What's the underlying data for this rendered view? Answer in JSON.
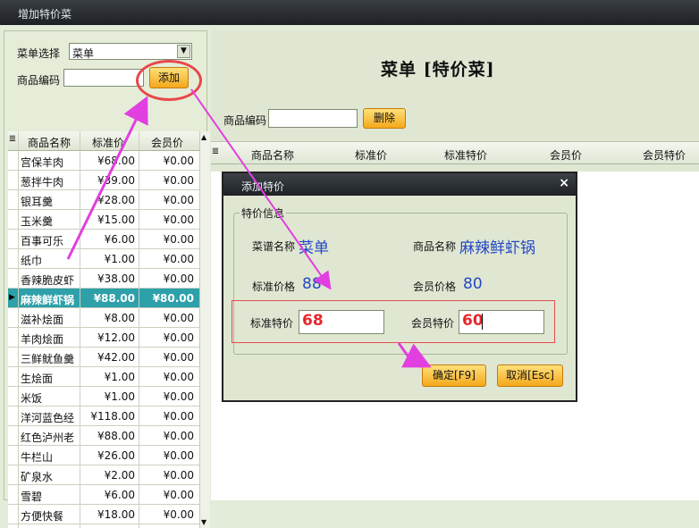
{
  "window": {
    "title": "增加特价菜"
  },
  "left": {
    "menu_select_label": "菜单选择",
    "menu_select_value": "菜单",
    "code_label": "商品编码",
    "code_value": "",
    "add_button": "添加",
    "columns": [
      "商品名称",
      "标准价",
      "会员价"
    ],
    "rows": [
      {
        "name": "宫保羊肉",
        "std": "¥68.00",
        "member": "¥0.00"
      },
      {
        "name": "葱拌牛肉",
        "std": "¥39.00",
        "member": "¥0.00"
      },
      {
        "name": "银耳羹",
        "std": "¥28.00",
        "member": "¥0.00"
      },
      {
        "name": "玉米羹",
        "std": "¥15.00",
        "member": "¥0.00"
      },
      {
        "name": "百事可乐",
        "std": "¥6.00",
        "member": "¥0.00"
      },
      {
        "name": "纸巾",
        "std": "¥1.00",
        "member": "¥0.00"
      },
      {
        "name": "香辣脆皮虾",
        "std": "¥38.00",
        "member": "¥0.00"
      },
      {
        "name": "麻辣鲜虾锅",
        "std": "¥88.00",
        "member": "¥80.00"
      },
      {
        "name": "滋补烩面",
        "std": "¥8.00",
        "member": "¥0.00"
      },
      {
        "name": "羊肉烩面",
        "std": "¥12.00",
        "member": "¥0.00"
      },
      {
        "name": "三鲜鱿鱼羹",
        "std": "¥42.00",
        "member": "¥0.00"
      },
      {
        "name": "生烩面",
        "std": "¥1.00",
        "member": "¥0.00"
      },
      {
        "name": "米饭",
        "std": "¥1.00",
        "member": "¥0.00"
      },
      {
        "name": "洋河蓝色经",
        "std": "¥118.00",
        "member": "¥0.00"
      },
      {
        "name": "红色泸州老",
        "std": "¥88.00",
        "member": "¥0.00"
      },
      {
        "name": "牛栏山",
        "std": "¥26.00",
        "member": "¥0.00"
      },
      {
        "name": "矿泉水",
        "std": "¥2.00",
        "member": "¥0.00"
      },
      {
        "name": "雪碧",
        "std": "¥6.00",
        "member": "¥0.00"
      },
      {
        "name": "方便快餐",
        "std": "¥18.00",
        "member": "¥0.00"
      }
    ],
    "selected_row_index": 7
  },
  "right": {
    "title": "菜单 [特价菜]",
    "code_label": "商品编码",
    "code_value": "",
    "delete_button": "删除",
    "columns": [
      "商品名称",
      "标准价",
      "标准特价",
      "会员价",
      "会员特价"
    ]
  },
  "dialog": {
    "title": "添加特价",
    "close_icon": "×",
    "group_label": "特价信息",
    "menu_name_label": "菜谱名称",
    "menu_name_value": "菜单",
    "product_name_label": "商品名称",
    "product_name_value": "麻辣鲜虾锅",
    "std_price_label": "标准价格",
    "std_price_value": "88",
    "member_price_label": "会员价格",
    "member_price_value": "80",
    "std_special_label": "标准特价",
    "std_special_value": "68",
    "member_special_label": "会员特价",
    "member_special_value": "60",
    "confirm_button": "确定[F9]",
    "cancel_button": "取消[Esc]"
  },
  "colors": {
    "accent": "#f4a81b",
    "selection": "#2ea0a9",
    "annotation": "#e23fe0",
    "highlight_red": "#e24c4c"
  }
}
